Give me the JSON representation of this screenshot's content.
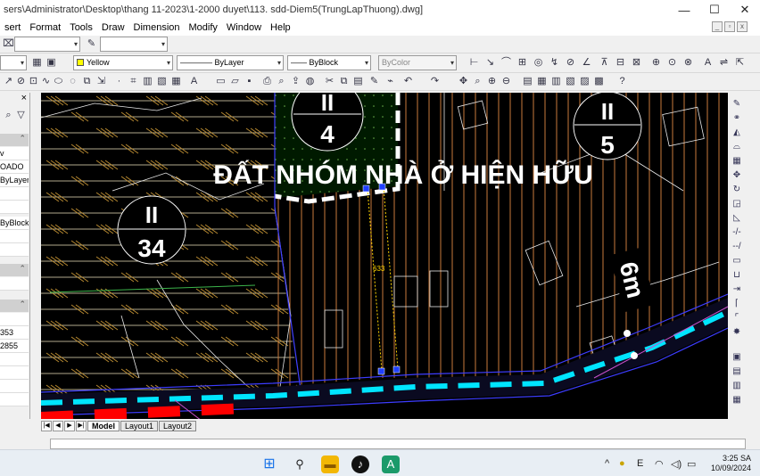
{
  "window": {
    "title": "sers\\Administrator\\Desktop\\thang 11-2023\\1-2000 duyet\\113. sdd-Diem5(TrungLapThuong).dwg]",
    "minimize": "—",
    "maximize": "☐",
    "close": "✕"
  },
  "menu": {
    "items": [
      "sert",
      "Format",
      "Tools",
      "Draw",
      "Dimension",
      "Modify",
      "Window",
      "Help"
    ],
    "mdi_min": "_",
    "mdi_restore": "▫",
    "mdi_close": "x"
  },
  "properties_bar": {
    "color": "Yellow",
    "linetype": "ByLayer",
    "lineweight": "ByBlock",
    "plotstyle": "ByColor"
  },
  "palette": {
    "close": "×",
    "rows": [
      "v",
      "OADO",
      "ByLayer",
      "ByBlock",
      "353",
      "2855"
    ]
  },
  "drawing": {
    "zone_heading": "ĐẤT NHÓM NHÀ Ở HIỆN HỮU",
    "road_label": "6m",
    "dimension_label": "633",
    "zones": [
      {
        "code": "II",
        "number": "4"
      },
      {
        "code": "II",
        "number": "5"
      },
      {
        "code": "II",
        "number": "34"
      }
    ]
  },
  "layout_tabs": {
    "nav": [
      "|◀",
      "◀",
      "▶",
      "▶|"
    ],
    "tabs": [
      "Model",
      "Layout1",
      "Layout2"
    ]
  },
  "taskbar": {
    "time": "3:25 SA",
    "date": "10/09/2024",
    "tray_chevron": "^",
    "ime": "E"
  },
  "colors": {
    "drawing_bg": "#000000",
    "hatch_orange": "#c87a3c",
    "road_cyan": "#00e5ff",
    "road_red": "#ff0000",
    "text_white": "#ffffff"
  }
}
